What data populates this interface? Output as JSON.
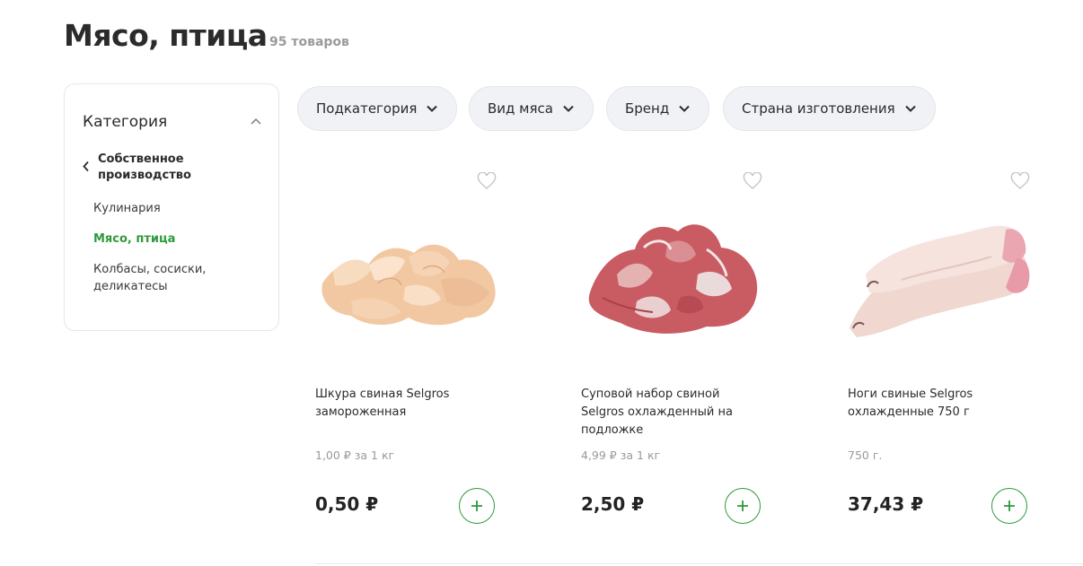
{
  "header": {
    "title": "Мясо, птица",
    "count": "95 товаров"
  },
  "sidebar": {
    "heading": "Категория",
    "back_label": "Собственное производство",
    "items": [
      {
        "label": "Кулинария",
        "active": false
      },
      {
        "label": "Мясо, птица",
        "active": true
      },
      {
        "label": "Колбасы, сосиски, деликатесы",
        "active": false
      }
    ]
  },
  "filters": [
    {
      "label": "Подкатегория"
    },
    {
      "label": "Вид мяса"
    },
    {
      "label": "Бренд"
    },
    {
      "label": "Страна изготовления"
    }
  ],
  "products": [
    {
      "name": "Шкура свиная Selgros замороженная",
      "unit_price": "1,00 ₽ за 1 кг",
      "price": "0,50 ₽",
      "image": "pork-skin-image"
    },
    {
      "name": "Суповой набор свиной Selgros охлажденный на подложке",
      "unit_price": "4,99 ₽ за 1 кг",
      "price": "2,50 ₽",
      "image": "pork-soup-set-image"
    },
    {
      "name": "Ноги свиные Selgros охлажденные 750 г",
      "unit_price": "750 г.",
      "price": "37,43 ₽",
      "image": "pork-legs-image"
    }
  ],
  "icons": {
    "chevron": "chevron-down-icon",
    "collapse": "chevron-up-icon",
    "back": "chevron-left-icon",
    "favorite": "heart-icon",
    "add": "plus-icon"
  },
  "colors": {
    "accent": "#2e9a3b",
    "muted": "#9a9a9a",
    "chip_bg": "#f0f2f5"
  }
}
